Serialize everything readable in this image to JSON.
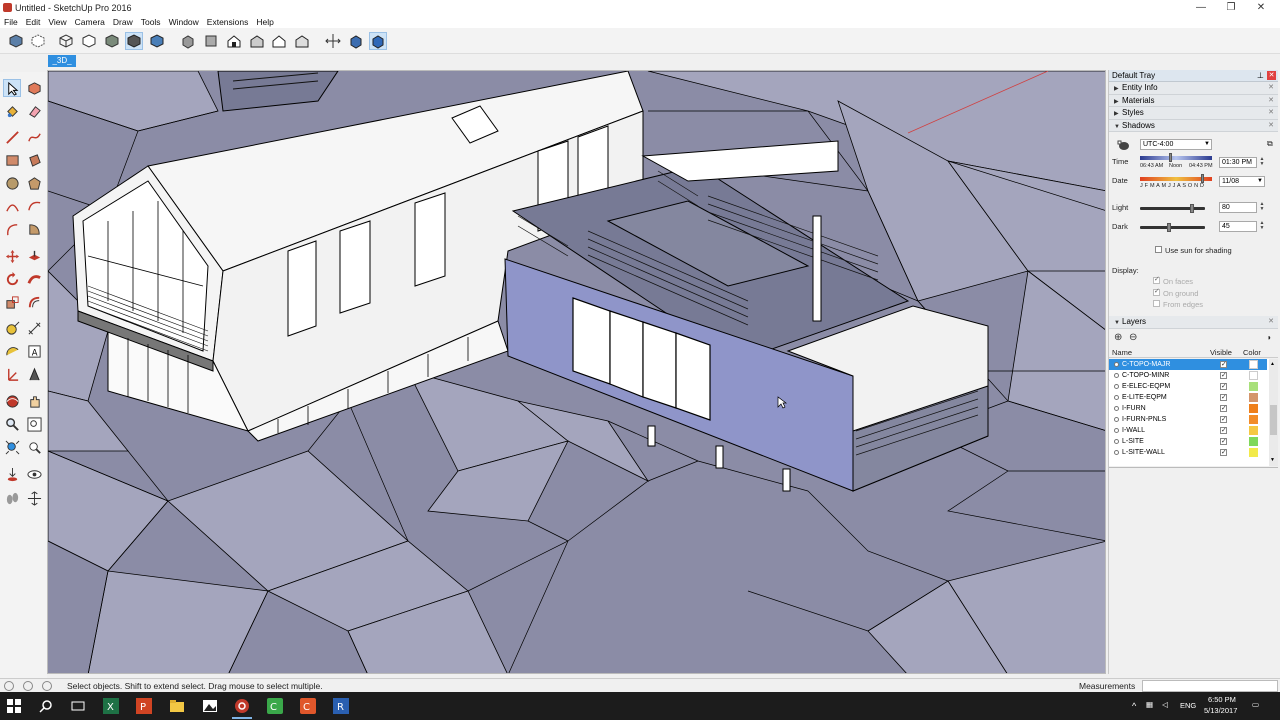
{
  "window": {
    "title": "Untitled - SketchUp Pro 2016",
    "minimize_glyph": "—",
    "restore_glyph": "❐",
    "close_glyph": "✕"
  },
  "menu": [
    "File",
    "Edit",
    "View",
    "Camera",
    "Draw",
    "Tools",
    "Window",
    "Extensions",
    "Help"
  ],
  "scene_tab": "_3D_",
  "tray": {
    "title": "Default Tray",
    "panels": {
      "entity_info": "Entity Info",
      "materials": "Materials",
      "styles": "Styles",
      "shadows": "Shadows",
      "layers": "Layers"
    },
    "shadows": {
      "timezone": "UTC-4:00",
      "time_label": "Time",
      "time_start": "06:43 AM",
      "time_mid": "Noon",
      "time_end": "04:43 PM",
      "time_value": "01:30 PM",
      "date_label": "Date",
      "months": "J F M A M J J A S O N D",
      "date_value": "11/08",
      "light_label": "Light",
      "light_value": "80",
      "light_fraction": 0.8,
      "dark_label": "Dark",
      "dark_value": "45",
      "dark_fraction": 0.45,
      "use_sun_label": "Use sun for shading",
      "display_label": "Display:",
      "on_faces": "On faces",
      "on_ground": "On ground",
      "from_edges": "From edges"
    },
    "layers": {
      "col_name": "Name",
      "col_visible": "Visible",
      "col_color": "Color",
      "items": [
        {
          "name": "C-TOPO-MAJR",
          "color": "#ffffff",
          "selected": true
        },
        {
          "name": "C-TOPO-MINR",
          "color": "#ffffff",
          "selected": false
        },
        {
          "name": "E-ELEC-EQPM",
          "color": "#a8e07a",
          "selected": false
        },
        {
          "name": "E-LITE-EQPM",
          "color": "#d4956a",
          "selected": false
        },
        {
          "name": "I-FURN",
          "color": "#ef7f1a",
          "selected": false
        },
        {
          "name": "I-FURN-PNLS",
          "color": "#f28c28",
          "selected": false
        },
        {
          "name": "I-WALL",
          "color": "#f5c842",
          "selected": false
        },
        {
          "name": "L-SITE",
          "color": "#7fd85a",
          "selected": false
        },
        {
          "name": "L-SITE-WALL",
          "color": "#f2ea4a",
          "selected": false
        }
      ]
    }
  },
  "status": {
    "hint": "Select objects. Shift to extend select. Drag mouse to select multiple.",
    "measurements_label": "Measurements"
  },
  "taskbar": {
    "lang": "ENG",
    "time": "6:50 PM",
    "date": "5/13/2017"
  },
  "colors": {
    "terrain": "#8c8ea8",
    "terrain_light": "#a3a4bc",
    "wall_blue": "#8f95c9",
    "selection": "#2f8fe0"
  }
}
